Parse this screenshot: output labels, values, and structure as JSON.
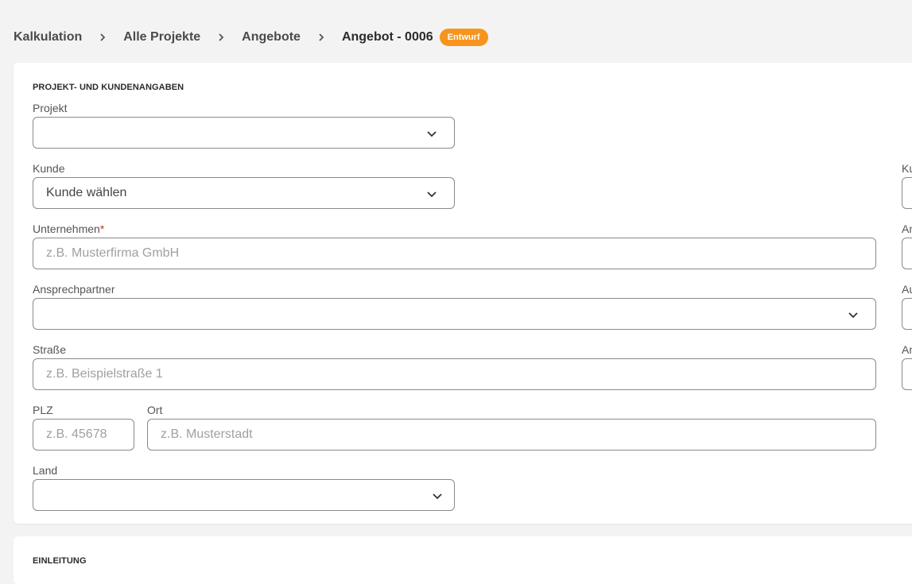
{
  "breadcrumb": {
    "items": [
      "Kalkulation",
      "Alle Projekte",
      "Angebote"
    ],
    "current": "Angebot - 0006",
    "badge": "Entwurf"
  },
  "section1": {
    "title": "PROJEKT- UND KUNDENANGABEN",
    "projekt": {
      "label": "Projekt",
      "value": ""
    },
    "kunde": {
      "label": "Kunde",
      "value": "Kunde wählen"
    },
    "unternehmen": {
      "label": "Unternehmen",
      "required": "*",
      "placeholder": "z.B. Musterfirma GmbH"
    },
    "ansprechpartner": {
      "label": "Ansprechpartner",
      "value": ""
    },
    "strasse": {
      "label": "Straße",
      "placeholder": "z.B. Beispielstraße 1"
    },
    "plz": {
      "label": "PLZ",
      "placeholder": "z.B. 45678"
    },
    "ort": {
      "label": "Ort",
      "placeholder": "z.B. Musterstadt"
    },
    "land": {
      "label": "Land",
      "value": ""
    }
  },
  "right_column_labels": [
    "Ku",
    "An",
    "Au",
    "An"
  ],
  "section2": {
    "title": "EINLEITUNG"
  },
  "colors": {
    "badge": "#f7941d",
    "required": "#c0392b",
    "border": "#8a8a8a"
  }
}
